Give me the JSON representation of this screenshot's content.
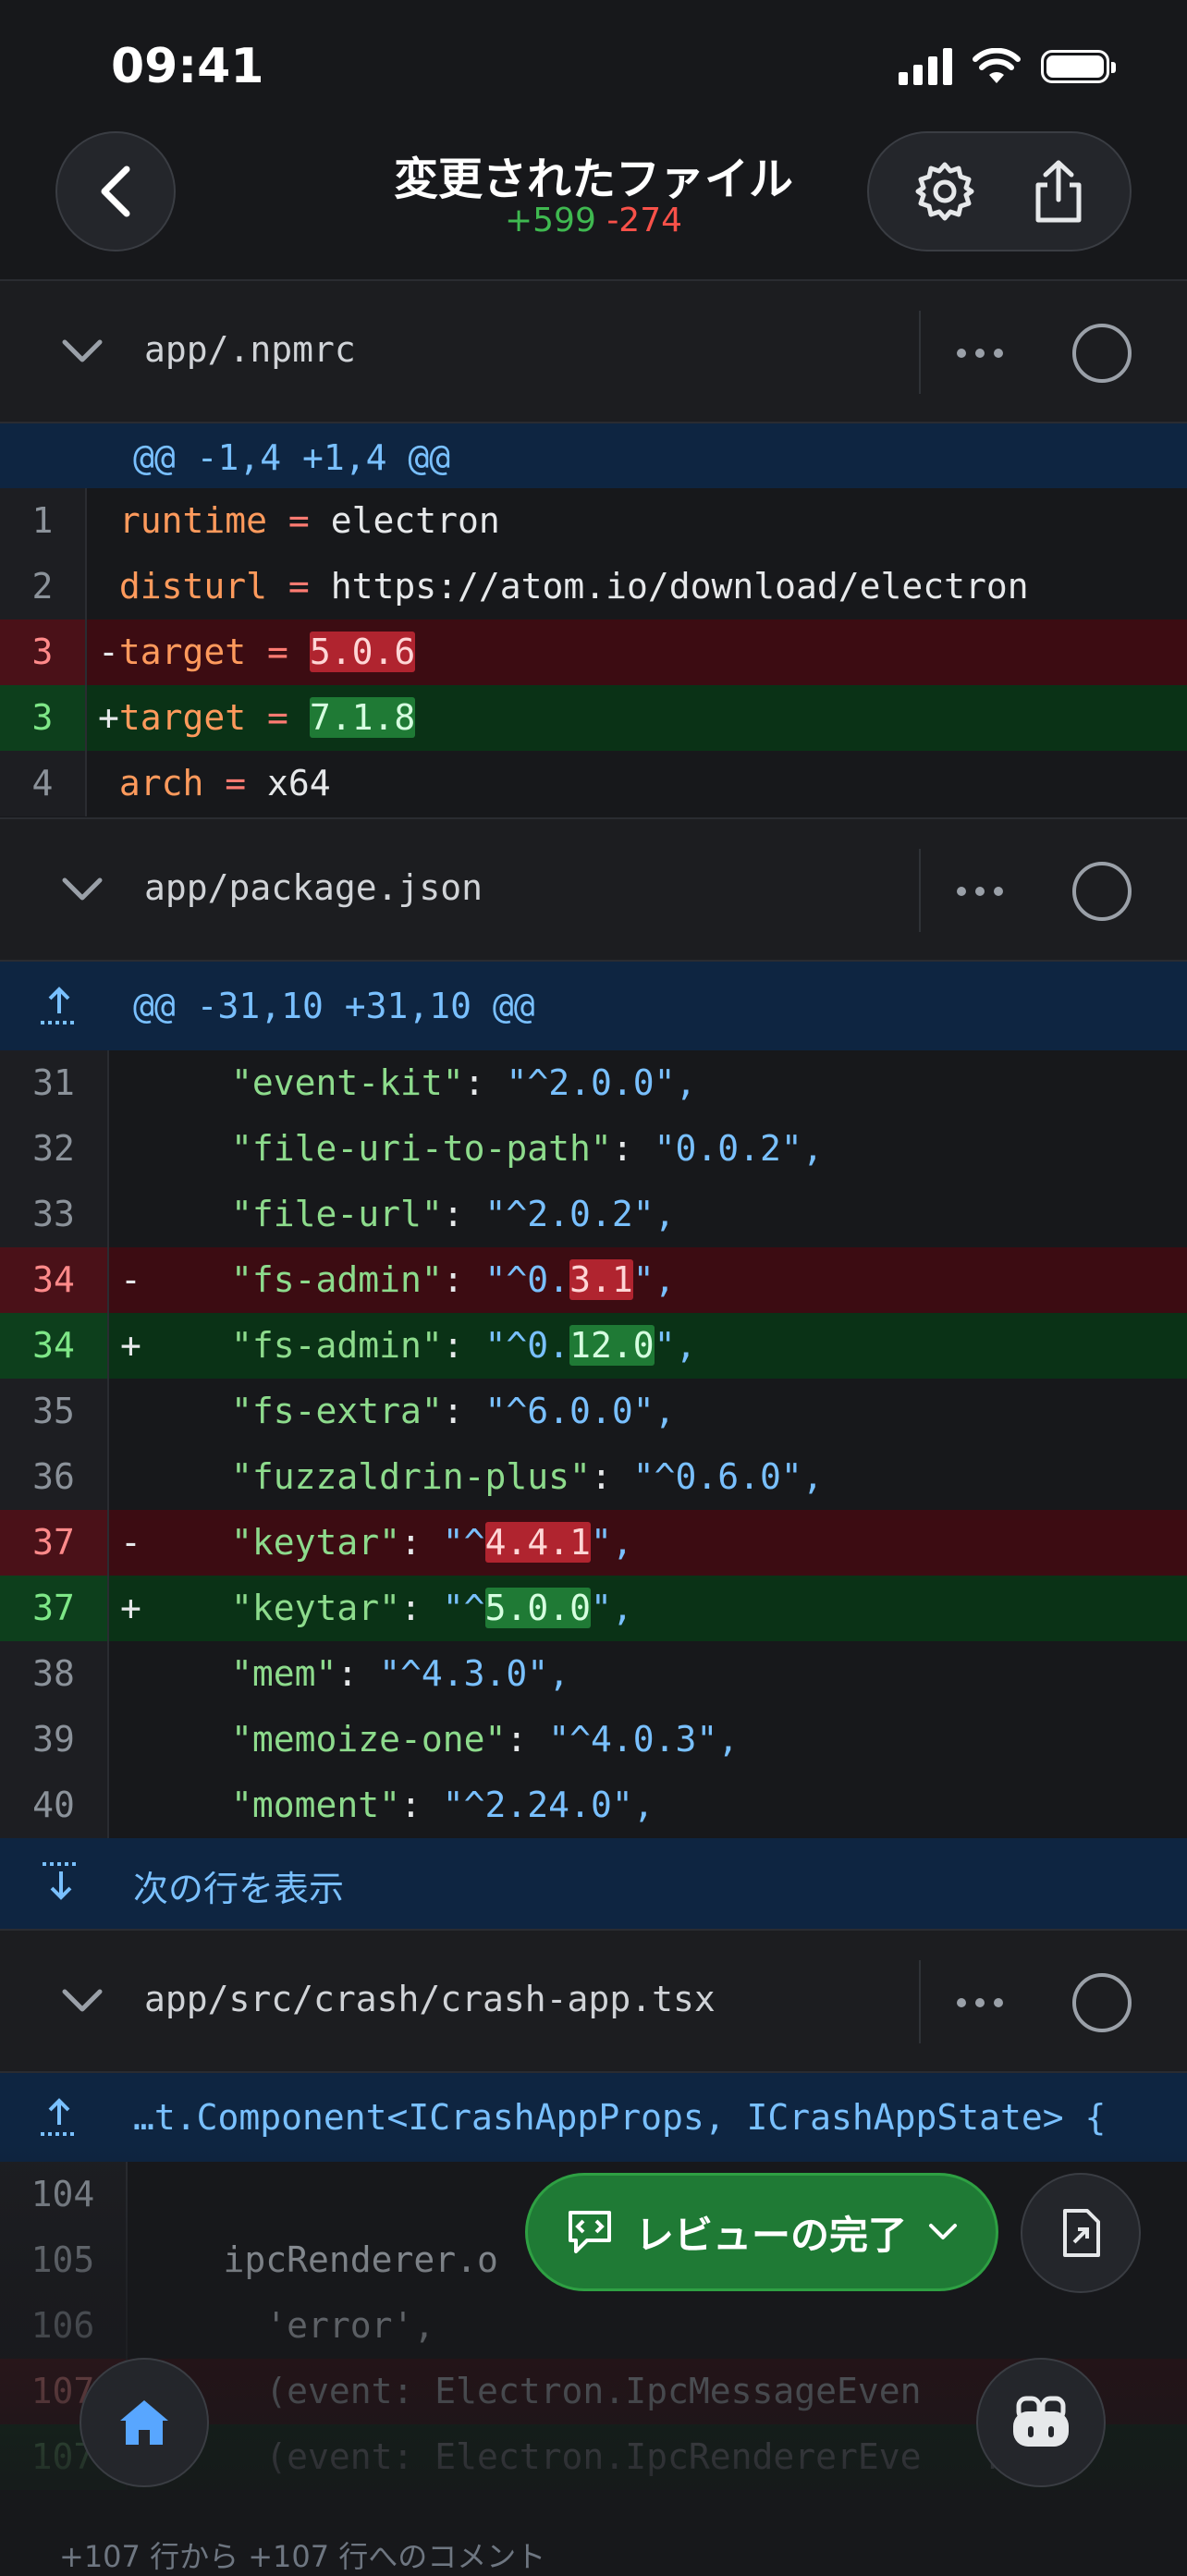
{
  "status": {
    "time": "09:41"
  },
  "header": {
    "title": "変更されたファイル",
    "additions": "+599",
    "deletions": "-274"
  },
  "files": [
    {
      "path": "app/.npmrc",
      "hunk": "@@ -1,4 +1,4 @@",
      "lines": [
        {
          "n": "1",
          "t": "ctx",
          "pre": " ",
          "k": "runtime",
          "v": "electron"
        },
        {
          "n": "2",
          "t": "ctx",
          "pre": " ",
          "k": "disturl",
          "v": "https://atom.io/download/electron"
        },
        {
          "n": "3",
          "t": "rm",
          "pre": "-",
          "k": "target",
          "v": "5.0.6"
        },
        {
          "n": "3",
          "t": "ad",
          "pre": "+",
          "k": "target",
          "v": "7.1.8"
        },
        {
          "n": "4",
          "t": "ctx",
          "pre": " ",
          "k": "arch",
          "v": "x64"
        }
      ]
    },
    {
      "path": "app/package.json",
      "hunk": "@@ -31,10 +31,10 @@",
      "lines": [
        {
          "n": "31",
          "t": "ctx",
          "sign": "",
          "key": "\"event-kit\"",
          "vpre": "\"^2.0.0\"",
          "vhl": "",
          "vpost": ",",
          "": ""
        },
        {
          "n": "32",
          "t": "ctx",
          "sign": "",
          "key": "\"file-uri-to-path\"",
          "vpre": "\"0.0.2\"",
          "vhl": "",
          "vpost": ","
        },
        {
          "n": "33",
          "t": "ctx",
          "sign": "",
          "key": "\"file-url\"",
          "vpre": "\"^2.0.2\"",
          "vhl": "",
          "vpost": ","
        },
        {
          "n": "34",
          "t": "rm",
          "sign": "-",
          "key": "\"fs-admin\"",
          "vpre": "\"^0.",
          "vhl": "3.1",
          "vpost": "\","
        },
        {
          "n": "34",
          "t": "ad",
          "sign": "+",
          "key": "\"fs-admin\"",
          "vpre": "\"^0.",
          "vhl": "12.0",
          "vpost": "\","
        },
        {
          "n": "35",
          "t": "ctx",
          "sign": "",
          "key": "\"fs-extra\"",
          "vpre": "\"^6.0.0\"",
          "vhl": "",
          "vpost": ","
        },
        {
          "n": "36",
          "t": "ctx",
          "sign": "",
          "key": "\"fuzzaldrin-plus\"",
          "vpre": "\"^0.6.0\"",
          "vhl": "",
          "vpost": ","
        },
        {
          "n": "37",
          "t": "rm",
          "sign": "-",
          "key": "\"keytar\"",
          "vpre": "\"^",
          "vhl": "4.4.1",
          "vpost": "\","
        },
        {
          "n": "37",
          "t": "ad",
          "sign": "+",
          "key": "\"keytar\"",
          "vpre": "\"^",
          "vhl": "5.0.0",
          "vpost": "\","
        },
        {
          "n": "38",
          "t": "ctx",
          "sign": "",
          "key": "\"mem\"",
          "vpre": "\"^4.3.0\"",
          "vhl": "",
          "vpost": ","
        },
        {
          "n": "39",
          "t": "ctx",
          "sign": "",
          "key": "\"memoize-one\"",
          "vpre": "\"^4.0.3\"",
          "vhl": "",
          "vpost": ","
        },
        {
          "n": "40",
          "t": "ctx",
          "sign": "",
          "key": "\"moment\"",
          "vpre": "\"^2.24.0\"",
          "vhl": "",
          "vpost": ","
        }
      ],
      "show_more": "次の行を表示"
    },
    {
      "path": "app/src/crash/crash-app.tsx",
      "hunk": "…t.Component<ICrashAppProps, ICrashAppState> {",
      "lines": [
        {
          "n": "104",
          "t": "ctx",
          "text": ""
        },
        {
          "n": "105",
          "t": "ctx",
          "text": "    ipcRenderer.o"
        },
        {
          "n": "106",
          "t": "ctx",
          "text": "      'error',"
        },
        {
          "n": "107",
          "t": "rm",
          "text": "      (event: Electron.IpcMessageEven   rashD"
        },
        {
          "n": "107",
          "t": "ad",
          "text": "      (event: Electron.IpcRendererEve   rash"
        }
      ]
    }
  ],
  "review_button": {
    "label": "レビューの完了"
  },
  "comment_note": "+107 行から +107 行へのコメント",
  "colors": {
    "add": "#3fb950",
    "delete": "#f85149",
    "hunk_bg": "#0e2541",
    "accent_green": "#1f7a35"
  },
  "icons": [
    "back-chevron-icon",
    "gear-icon",
    "share-icon",
    "chevron-down-icon",
    "more-icon",
    "circle-icon",
    "expand-up-icon",
    "expand-down-icon",
    "comment-icon",
    "file-diff-icon",
    "home-icon",
    "copilot-icon"
  ]
}
